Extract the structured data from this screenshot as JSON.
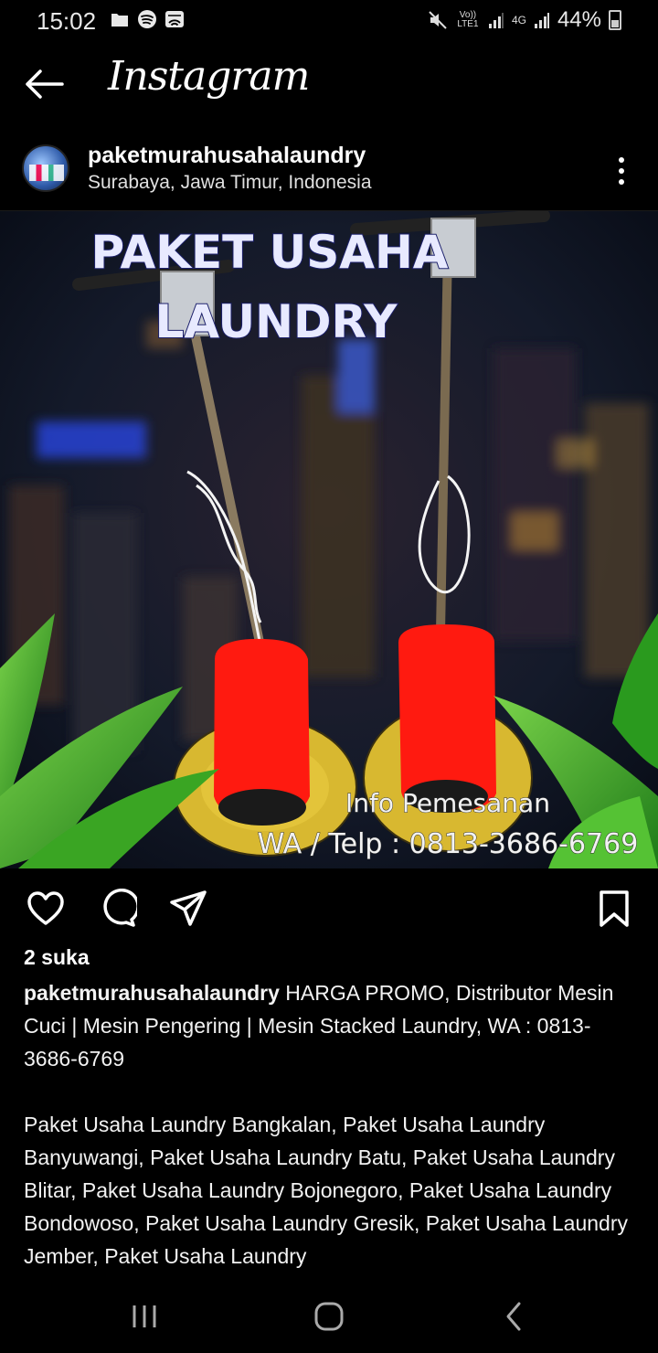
{
  "status_bar": {
    "time": "15:02",
    "left_icons": [
      "gallery-icon",
      "spotify-icon",
      "screen-mirror-icon"
    ],
    "mute_icon": "mute-icon",
    "volte_label": "Vo)) LTE1",
    "network_label": "4G",
    "battery": "44%"
  },
  "header": {
    "title": "Instagram",
    "back_icon": "back-arrow-icon"
  },
  "post": {
    "username": "paketmurahusahalaundry",
    "location": "Surabaya, Jawa Timur, Indonesia",
    "more_icon": "more-vertical-icon",
    "image": {
      "headline_line1": "PAKET USAHA",
      "headline_line2": "LAUNDRY",
      "info_line1": "Info Pemesanan",
      "info_line2": "WA / Telp : 0813-3686-6769"
    },
    "actions": [
      "like-icon",
      "comment-icon",
      "share-icon",
      "save-icon"
    ],
    "likes": "2 suka",
    "caption_user": "paketmurahusahalaundry",
    "caption_text": " HARGA PROMO, Distributor Mesin Cuci | Mesin Pengering | Mesin Stacked Laundry, WA : 0813-3686-6769",
    "caption_more": "Paket Usaha Laundry Bangkalan, Paket Usaha Laundry Banyuwangi, Paket Usaha Laundry Batu, Paket Usaha Laundry Blitar, Paket Usaha Laundry Bojonegoro, Paket Usaha Laundry Bondowoso, Paket Usaha Laundry Gresik, Paket Usaha Laundry Jember, Paket Usaha Laundry"
  },
  "nav": [
    "recent-apps-icon",
    "home-icon",
    "back-icon"
  ],
  "colors": {
    "background": "#000000",
    "text": "#ffffff",
    "headline": "#e8eaff",
    "machine_red": "#ff1a10",
    "machine_yellow": "#e3c43a",
    "leaf_green": "#49b82c"
  }
}
